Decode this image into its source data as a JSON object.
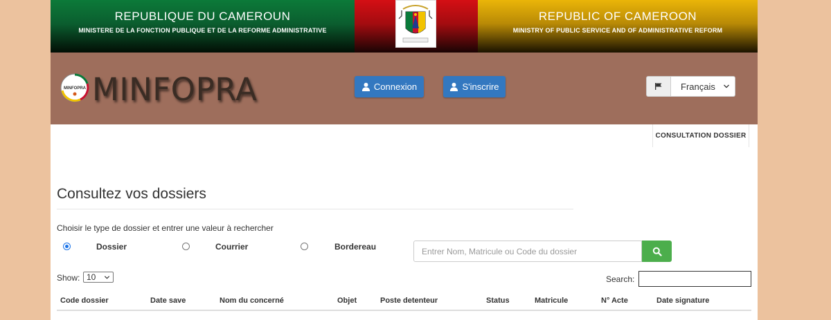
{
  "banner": {
    "left_title": "REPUBLIQUE DU CAMEROUN",
    "left_subtitle": "MINISTERE DE LA FONCTION PUBLIQUE ET DE LA REFORME ADMINISTRATIVE",
    "right_title": "REPUBLIC OF CAMEROON",
    "right_subtitle": "MINISTRY OF PUBLIC SERVICE AND OF ADMINISTRATIVE REFORM",
    "colors": {
      "green": "#0b6b34",
      "red": "#c40e12",
      "yellow": "#d9a407"
    },
    "emblem": "coat-of-arms-icon"
  },
  "nav": {
    "logo_text": "MINFOPRA",
    "logo_icon_text": "MINFOPRA",
    "connexion_label": "Connexion",
    "inscrire_label": "S'inscrire",
    "language_selected": "Français",
    "flag_icon": "flag-icon",
    "user_icon": "user-icon",
    "background": "#9e6e5c",
    "button_color": "#3378c0"
  },
  "tabs": {
    "consultation": "CONSULTATION DOSSIER"
  },
  "main": {
    "title": "Consultez vos dossiers",
    "instruction": "Choisir le type de dossier et entrer une valeur à rechercher",
    "radios": [
      {
        "label": "Dossier",
        "checked": true
      },
      {
        "label": "Courrier",
        "checked": false
      },
      {
        "label": "Bordereau",
        "checked": false
      }
    ],
    "search_placeholder": "Entrer Nom, Matricule ou Code du dossier",
    "search_button_icon": "search-icon",
    "search_button_color": "#4cae4c"
  },
  "table": {
    "show_label": "Show:",
    "page_size": "10",
    "search_label": "Search:",
    "columns": [
      "Code dossier",
      "Date save",
      "Nom du concerné",
      "Objet",
      "Poste detenteur",
      "Status",
      "Matricule",
      "N° Acte",
      "Date signature"
    ]
  }
}
